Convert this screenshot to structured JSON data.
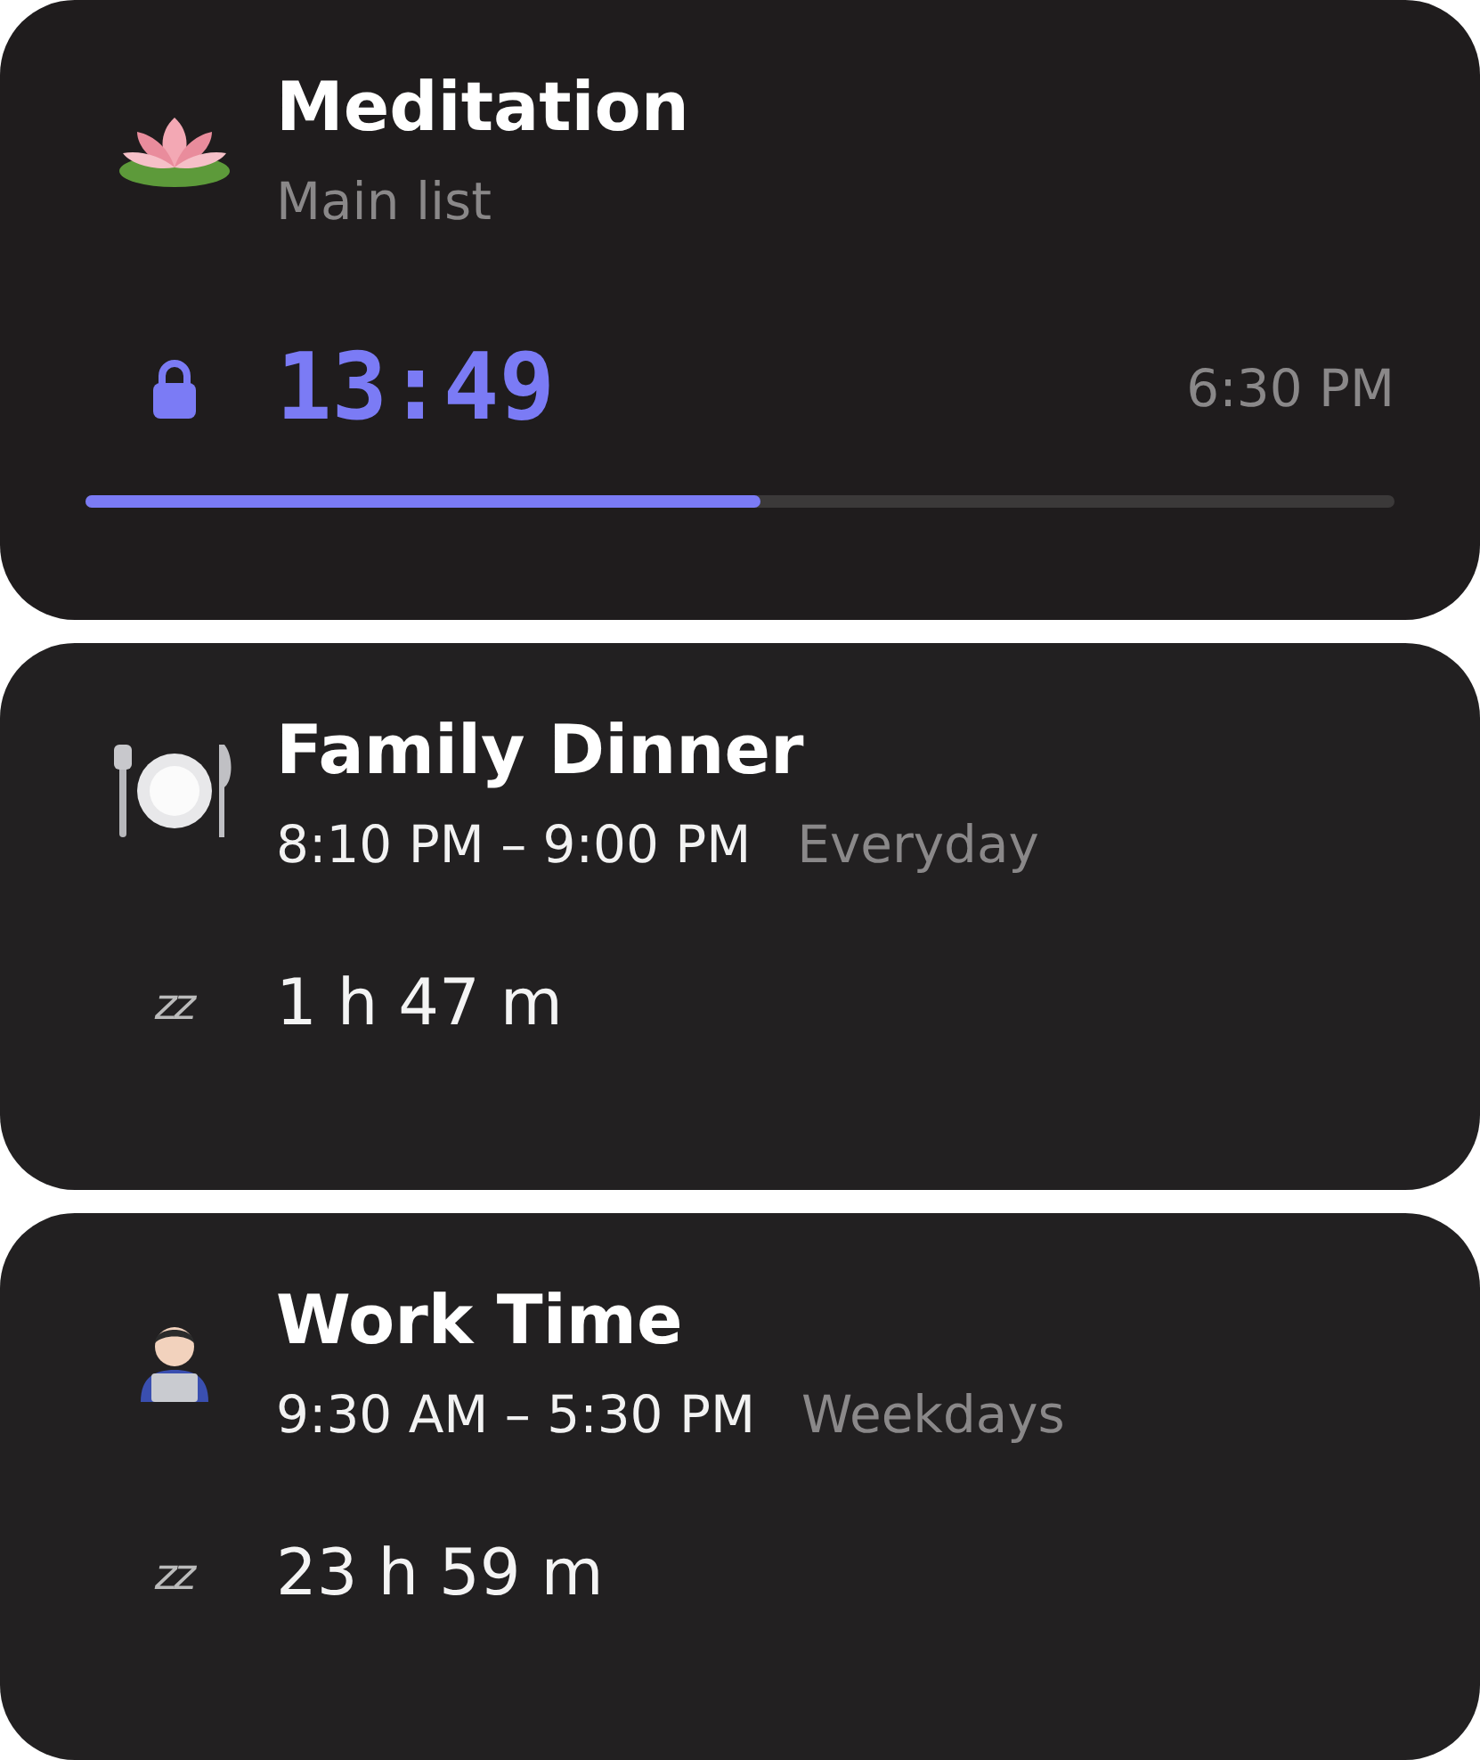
{
  "cards": [
    {
      "kind": "active",
      "title": "Meditation",
      "subtitle": "Main list",
      "locked": true,
      "timer": "13:49",
      "end_time": "6:30 PM",
      "level": 0.515
    },
    {
      "kind": "scheduled",
      "title": "Family Dinner",
      "time_range": "8:10 PM – 9:00 PM",
      "repeat": "Everyday",
      "sleep_icon": "zz",
      "remaining": "1 h 47 m"
    },
    {
      "kind": "scheduled",
      "title": "Work Time",
      "time_range": "9:30 AM – 5:30 PM",
      "repeat": "Weekdays",
      "sleep_icon": "zz",
      "remaining": "23 h 59 m"
    }
  ]
}
